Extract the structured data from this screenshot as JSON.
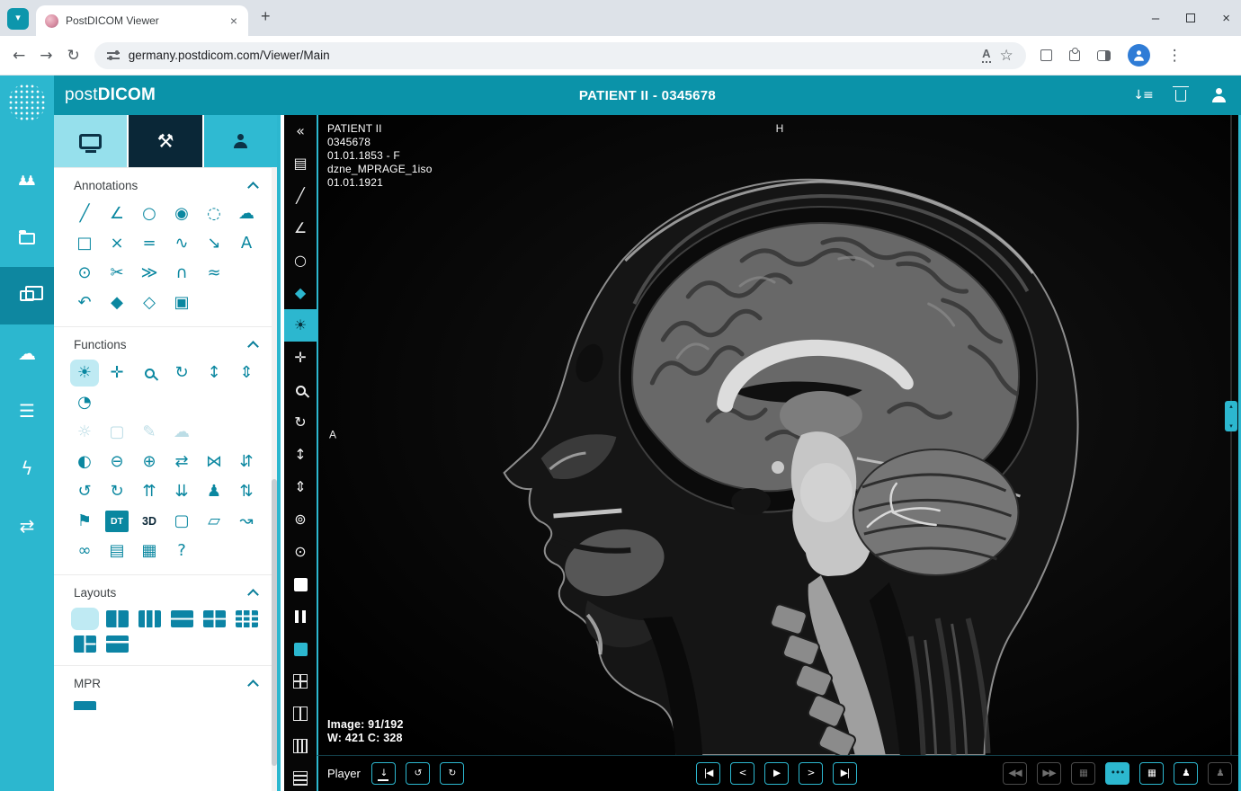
{
  "glyphs": {
    "tab_chevron": "▾",
    "plus": "+",
    "close": "×",
    "minimize": "–",
    "back": "←",
    "forward": "→",
    "reload": "↻",
    "star": "☆",
    "menu": "⋮",
    "translate": "A",
    "tools_tab": "⚒",
    "scroll_up": "▴",
    "scroll_down": "▾"
  },
  "browser": {
    "tab_title": "PostDICOM Viewer",
    "url": "germany.postdicom.com/Viewer/Main"
  },
  "header": {
    "logo_post": "post",
    "logo_dicom": "DICOM",
    "title": "PATIENT II - 0345678",
    "icons": [
      {
        "name": "sort-icon",
        "glyph": "↓≡"
      },
      {
        "name": "delete-study-icon",
        "cls": "i-trash"
      },
      {
        "name": "account-icon",
        "cls": "i-person"
      }
    ]
  },
  "rail": {
    "items": [
      {
        "name": "patients-icon",
        "glyph": "♟♟",
        "cls": "tight"
      },
      {
        "name": "folders-icon",
        "cls": "i-folder"
      },
      {
        "name": "viewer-icon",
        "cls": "i-cards",
        "state": "active"
      },
      {
        "name": "upload-icon",
        "glyph": "☁"
      },
      {
        "name": "worklist-icon",
        "glyph": "☰"
      },
      {
        "name": "share-icon",
        "glyph": "ϟ"
      },
      {
        "name": "transfer-icon",
        "glyph": "⇄"
      }
    ]
  },
  "panel": {
    "annotations": {
      "label": "Annotations",
      "icons": [
        {
          "name": "length-icon",
          "glyph": "╱"
        },
        {
          "name": "angle-icon",
          "glyph": "∠"
        },
        {
          "name": "circle-icon",
          "glyph": "○"
        },
        {
          "name": "shaded-circle-icon",
          "glyph": "◉"
        },
        {
          "name": "ellipse-icon",
          "glyph": "◌"
        },
        {
          "name": "freehand-icon",
          "glyph": "☁"
        },
        {
          "name": "rectangle-icon",
          "glyph": "□"
        },
        {
          "name": "probe-icon",
          "glyph": "×"
        },
        {
          "name": "parallel-lines-icon",
          "glyph": "="
        },
        {
          "name": "polyline-icon",
          "glyph": "∿"
        },
        {
          "name": "arrow-icon",
          "glyph": "↘"
        },
        {
          "name": "text-icon",
          "glyph": "A"
        },
        {
          "name": "point-icon",
          "glyph": "⊙"
        },
        {
          "name": "cobb-angle-icon",
          "glyph": "✂"
        },
        {
          "name": "flow-icon",
          "glyph": "≫"
        },
        {
          "name": "closed-curve-icon",
          "glyph": "∩"
        },
        {
          "name": "spline-icon",
          "glyph": "≈"
        },
        {
          "name": "spacer",
          "cls": "sp"
        },
        {
          "name": "undo-icon",
          "glyph": "↶"
        },
        {
          "name": "delete-annotation-icon",
          "glyph": "◆"
        },
        {
          "name": "delete-all-annotations-icon",
          "glyph": "◇"
        },
        {
          "name": "copy-annotations-icon",
          "glyph": "▣"
        },
        {
          "name": "spacer",
          "cls": "sp"
        },
        {
          "name": "spacer",
          "cls": "sp"
        }
      ]
    },
    "functions": {
      "label": "Functions",
      "icons": [
        {
          "name": "window-level-icon",
          "glyph": "☀",
          "state": "active"
        },
        {
          "name": "pan-icon",
          "glyph": "✛"
        },
        {
          "name": "zoom-icon",
          "cls": "i-mag"
        },
        {
          "name": "rotate-icon",
          "glyph": "↻"
        },
        {
          "name": "stack-scroll-icon",
          "glyph": "↕"
        },
        {
          "name": "sort-stack-icon",
          "glyph": "⇕"
        },
        {
          "name": "quarter-probe-icon",
          "glyph": "◔"
        },
        {
          "name": "spacer",
          "cls": "sp"
        },
        {
          "name": "spacer",
          "cls": "sp"
        },
        {
          "name": "spacer",
          "cls": "sp"
        },
        {
          "name": "spacer",
          "cls": "sp"
        },
        {
          "name": "spacer",
          "cls": "sp"
        },
        {
          "name": "wl-region-icon",
          "glyph": "☼",
          "state": "disabled"
        },
        {
          "name": "crop-icon",
          "glyph": "▢",
          "state": "disabled"
        },
        {
          "name": "draw-icon",
          "glyph": "✎",
          "state": "disabled"
        },
        {
          "name": "freehand-wl-icon",
          "glyph": "☁",
          "state": "disabled"
        },
        {
          "name": "spacer",
          "cls": "sp"
        },
        {
          "name": "spacer",
          "cls": "sp"
        },
        {
          "name": "invert-icon",
          "glyph": "◐"
        },
        {
          "name": "zoom-out-icon",
          "glyph": "⊖"
        },
        {
          "name": "zoom-in-icon",
          "glyph": "⊕"
        },
        {
          "name": "flip-horizontal-icon",
          "glyph": "⇄"
        },
        {
          "name": "mirror-horizontal-icon",
          "glyph": "⋈"
        },
        {
          "name": "flip-vertical-icon",
          "glyph": "⇵"
        },
        {
          "name": "rotate-ccw-icon",
          "glyph": "↺"
        },
        {
          "name": "rotate-cw-icon",
          "glyph": "↻"
        },
        {
          "name": "expand-vertical-icon",
          "glyph": "⇈"
        },
        {
          "name": "compress-vertical-icon",
          "glyph": "⇊"
        },
        {
          "name": "patient-orientation-icon",
          "glyph": "♟"
        },
        {
          "name": "swap-vertical-icon",
          "glyph": "⇅"
        },
        {
          "name": "tag-icon",
          "glyph": "⚑"
        },
        {
          "name": "dicom-tags-icon",
          "glyph": "DT",
          "cls": "i-badge"
        },
        {
          "name": "volume-3d-icon",
          "glyph": "3D",
          "cls": "i-badge-dark"
        },
        {
          "name": "reference-lines-icon",
          "glyph": "▢"
        },
        {
          "name": "shear-icon",
          "glyph": "▱"
        },
        {
          "name": "rotate-3d-icon",
          "glyph": "↝"
        },
        {
          "name": "cine-loop-icon",
          "glyph": "∞"
        },
        {
          "name": "export-image-icon",
          "glyph": "▤"
        },
        {
          "name": "annotate-image-icon",
          "glyph": "▦"
        },
        {
          "name": "patient-query-icon",
          "glyph": "?"
        },
        {
          "name": "spacer",
          "cls": "sp"
        },
        {
          "name": "spacer",
          "cls": "sp"
        }
      ]
    },
    "layouts": {
      "label": "Layouts",
      "icons": [
        {
          "name": "layout-1x1-icon",
          "cls": "lay",
          "state": "active"
        },
        {
          "name": "layout-1x2-icon",
          "cls": "lay lay-c2"
        },
        {
          "name": "layout-1x3-icon",
          "cls": "lay lay-c3"
        },
        {
          "name": "layout-2x1-icon",
          "cls": "lay lay-r2"
        },
        {
          "name": "layout-2x2-icon",
          "cls": "lay lay-22"
        },
        {
          "name": "layout-3x3-icon",
          "cls": "lay lay-33"
        },
        {
          "name": "layout-1-2-icon",
          "cls": "lay lay-22b"
        },
        {
          "name": "layout-2-rows-icon",
          "cls": "lay lay-r2b"
        }
      ]
    },
    "mpr": {
      "label": "MPR",
      "icons": [
        {
          "name": "mpr-preview-icon",
          "cls": "lay"
        }
      ]
    }
  },
  "toolbar": {
    "items": [
      {
        "name": "collapse-panel-icon",
        "glyph": "«"
      },
      {
        "name": "report-icon",
        "glyph": "▤"
      },
      {
        "name": "length-icon",
        "glyph": "╱"
      },
      {
        "name": "angle-icon",
        "glyph": "∠"
      },
      {
        "name": "ellipse-icon",
        "glyph": "○"
      },
      {
        "name": "delete-annotation-icon",
        "glyph": "◆",
        "cls": "cyan"
      },
      {
        "name": "window-level-icon",
        "glyph": "☀",
        "state": "active"
      },
      {
        "name": "pan-icon",
        "glyph": "✛"
      },
      {
        "name": "zoom-icon",
        "cls": "i-mag"
      },
      {
        "name": "rotate-icon",
        "glyph": "↻"
      },
      {
        "name": "stack-scroll-icon",
        "glyph": "↕"
      },
      {
        "name": "sort-stack-icon",
        "glyph": "⇕"
      },
      {
        "name": "reset-view-icon",
        "glyph": "⊚"
      },
      {
        "name": "orbit-icon",
        "glyph": "⊙"
      },
      {
        "name": "active-frame-icon",
        "cls": "sq sq-white"
      },
      {
        "name": "pause-icon",
        "cls": "i-pause"
      },
      {
        "name": "highlight-frame-icon",
        "cls": "sq sq-cyan"
      },
      {
        "name": "layout-grid-icon",
        "cls": "lay-sm l-22"
      },
      {
        "name": "layout-cols-icon",
        "cls": "lay-sm l-c2"
      },
      {
        "name": "layout-stripes-v-icon",
        "cls": "lay-sm l-v3"
      },
      {
        "name": "layout-stripes-h-icon",
        "cls": "lay-sm l-h4"
      }
    ]
  },
  "viewer": {
    "patient_lines": [
      "PATIENT II",
      "0345678",
      "01.01.1853 - F",
      "dzne_MPRAGE_1iso",
      "01.01.1921"
    ],
    "orient_top": "H",
    "orient_left": "A",
    "image_info_1": "Image: 91/192",
    "image_info_2": "W: 421 C: 328"
  },
  "player": {
    "label": "Player",
    "left_buttons": [
      {
        "name": "export-frame-button",
        "glyph": "↓",
        "cls": "i-dl"
      },
      {
        "name": "loop-backward-button",
        "glyph": "↺"
      },
      {
        "name": "loop-forward-button",
        "glyph": "↻"
      }
    ],
    "nav_buttons": [
      {
        "name": "first-frame-button",
        "glyph": "|◀"
      },
      {
        "name": "previous-frame-button",
        "glyph": "<"
      },
      {
        "name": "play-button",
        "glyph": "▶"
      },
      {
        "name": "next-frame-button",
        "glyph": ">"
      },
      {
        "name": "last-frame-button",
        "glyph": "▶|"
      }
    ],
    "right_buttons": [
      {
        "name": "fast-rewind-button",
        "glyph": "◀◀",
        "state": "disabled"
      },
      {
        "name": "fast-forward-button",
        "glyph": "▶▶",
        "state": "disabled"
      },
      {
        "name": "export-series-button",
        "glyph": "▦",
        "state": "disabled"
      },
      {
        "name": "more-options-button",
        "glyph": "•••",
        "state": "accent"
      },
      {
        "name": "expand-layout-button",
        "glyph": "▦"
      },
      {
        "name": "previous-patient-button",
        "glyph": "♟"
      },
      {
        "name": "next-patient-button",
        "glyph": "♟",
        "state": "disabled"
      }
    ]
  }
}
